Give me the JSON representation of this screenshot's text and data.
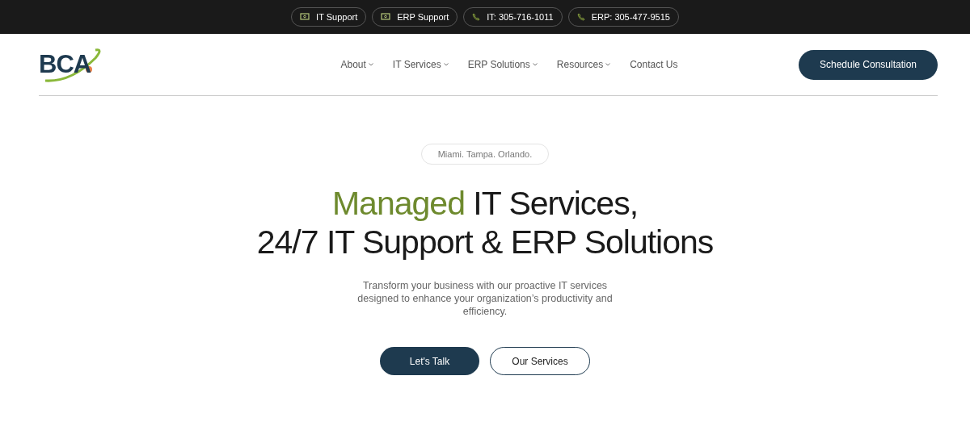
{
  "top_bar": {
    "links": [
      {
        "label": "IT Support",
        "kind": "laptop"
      },
      {
        "label": "ERP Support",
        "kind": "laptop"
      },
      {
        "label": "IT: 305-716-1011",
        "kind": "phone"
      },
      {
        "label": "ERP: 305-477-9515",
        "kind": "phone"
      }
    ]
  },
  "header": {
    "logo": "BCA",
    "nav": [
      {
        "label": "About",
        "dropdown": true
      },
      {
        "label": "IT Services",
        "dropdown": true
      },
      {
        "label": "ERP Solutions",
        "dropdown": true
      },
      {
        "label": "Resources",
        "dropdown": true
      },
      {
        "label": "Contact Us",
        "dropdown": false
      }
    ],
    "cta": "Schedule Consultation"
  },
  "hero": {
    "badge": "Miami. Tampa. Orlando.",
    "title_highlight": "Managed",
    "title_rest": "IT Services,",
    "title_line2": "24/7 IT Support & ERP Solutions",
    "text": "Transform your business with our proactive IT services designed to enhance your organization’s productivity and efficiency.",
    "buttons": [
      {
        "label": "Let's Talk",
        "kind": "primary"
      },
      {
        "label": "Our Services",
        "kind": "outline"
      }
    ]
  }
}
